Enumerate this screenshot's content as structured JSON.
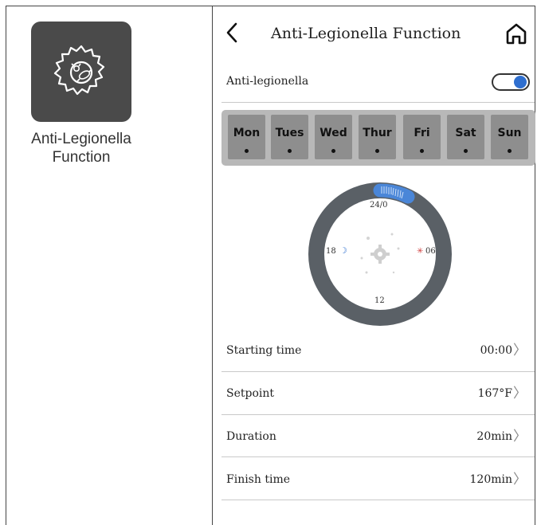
{
  "left": {
    "app_icon": "bacteria-gear-icon",
    "label_line1": "Anti-Legionella",
    "label_line2": "Function"
  },
  "header": {
    "back_icon": "back-chevron-icon",
    "title": "Anti-Legionella Function",
    "home_icon": "home-icon"
  },
  "toggle": {
    "label": "Anti-legionella",
    "on": true,
    "accent": "#2f6fcf"
  },
  "days": [
    "Mon",
    "Tues",
    "Wed",
    "Thur",
    "Fri",
    "Sat",
    "Sun"
  ],
  "clock": {
    "top_label": "24/0",
    "right_label": "06",
    "bottom_label": "12",
    "left_label": "18",
    "sun_icon": "sun-icon",
    "moon_icon": "moon-icon",
    "center_icon": "gear-icon"
  },
  "settings": [
    {
      "label": "Starting time",
      "value": "00:00"
    },
    {
      "label": "Setpoint",
      "value": "167°F"
    },
    {
      "label": "Duration",
      "value": "20min"
    },
    {
      "label": "Finish time",
      "value": "120min"
    }
  ]
}
